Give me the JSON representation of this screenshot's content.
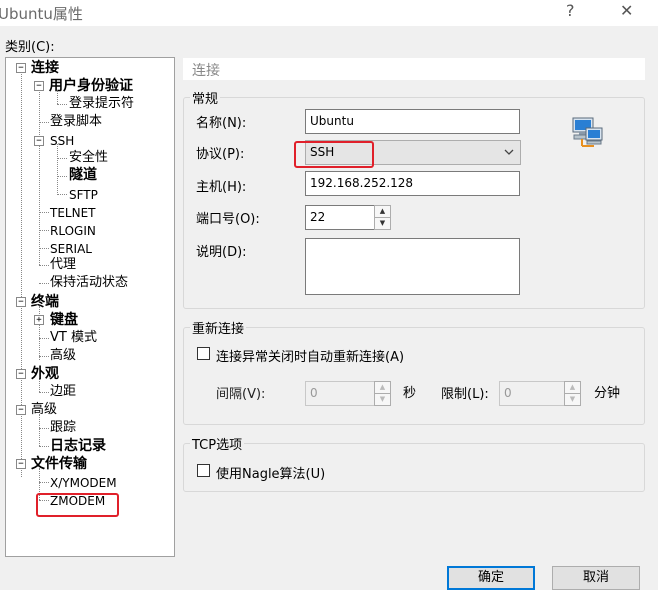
{
  "window": {
    "title": "Ubuntu属性",
    "help_glyph": "?",
    "close_glyph": "✕"
  },
  "category_label": "类别(C):",
  "tree": {
    "connection": "连接",
    "auth": "用户身份验证",
    "login_prompts": "登录提示符",
    "login_scripts": "登录脚本",
    "ssh": "SSH",
    "security": "安全性",
    "tunnel": "隧道",
    "sftp": "SFTP",
    "telnet": "TELNET",
    "rlogin": "RLOGIN",
    "serial": "SERIAL",
    "proxy": "代理",
    "keepalive": "保持活动状态",
    "terminal": "终端",
    "keyboard": "键盘",
    "vt_mode": "VT 模式",
    "advanced": "高级",
    "appearance": "外观",
    "margin": "边距",
    "advanced2": "高级",
    "trace": "跟踪",
    "logging": "日志记录",
    "file_transfer": "文件传输",
    "xymodem": "X/YMODEM",
    "zmodem": "ZMODEM"
  },
  "header": "连接",
  "general": {
    "title": "常规",
    "name_label": "名称(N):",
    "name_value": "Ubuntu",
    "protocol_label": "协议(P):",
    "protocol_value": "SSH",
    "host_label": "主机(H):",
    "host_value": "192.168.252.128",
    "port_label": "端口号(O):",
    "port_value": "22",
    "desc_label": "说明(D):",
    "desc_value": ""
  },
  "reconnect": {
    "title": "重新连接",
    "checkbox_label": "连接异常关闭时自动重新连接(A)",
    "interval_label": "间隔(V):",
    "interval_value": "0",
    "interval_unit": "秒",
    "limit_label": "限制(L):",
    "limit_value": "0",
    "limit_unit": "分钟"
  },
  "tcp": {
    "title": "TCP选项",
    "nagle_label": "使用Nagle算法(U)"
  },
  "buttons": {
    "ok": "确定",
    "cancel": "取消"
  },
  "colors": {
    "highlight": "#e0202a",
    "default_button": "#0078d7"
  }
}
